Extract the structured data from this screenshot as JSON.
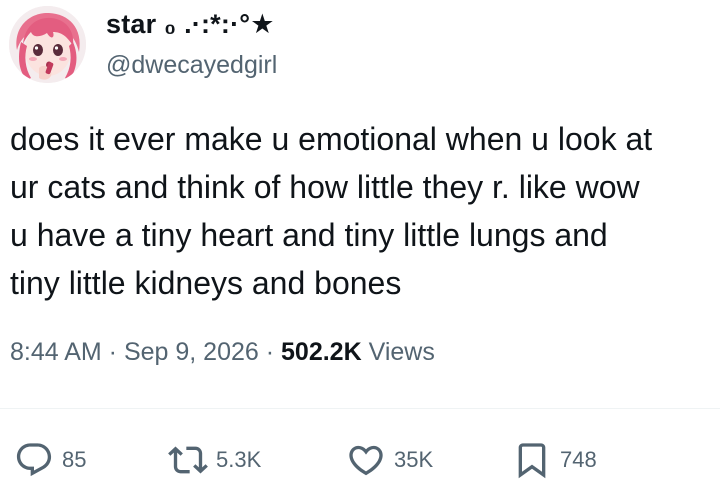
{
  "user": {
    "display_name": "star ₀ .·:*:·°★",
    "handle": "@dwecayedgirl",
    "avatar_icon": "anime-girl-avatar"
  },
  "tweet": {
    "lines": [
      "does it ever make u emotional when u look at",
      "ur cats and think of how little they r. like wow",
      "u have a tiny heart and tiny little lungs and",
      "tiny little kidneys and bones"
    ]
  },
  "meta": {
    "time": "8:44 AM",
    "date": "Sep 9, 2026",
    "separator": " · ",
    "views_count": "502.2K",
    "views_label": "Views"
  },
  "actions": {
    "replies": "85",
    "retweets": "5.3K",
    "likes": "35K",
    "bookmarks": "748"
  },
  "colors": {
    "text_primary": "#0f1419",
    "text_secondary": "#536471",
    "divider": "#eff3f4"
  }
}
